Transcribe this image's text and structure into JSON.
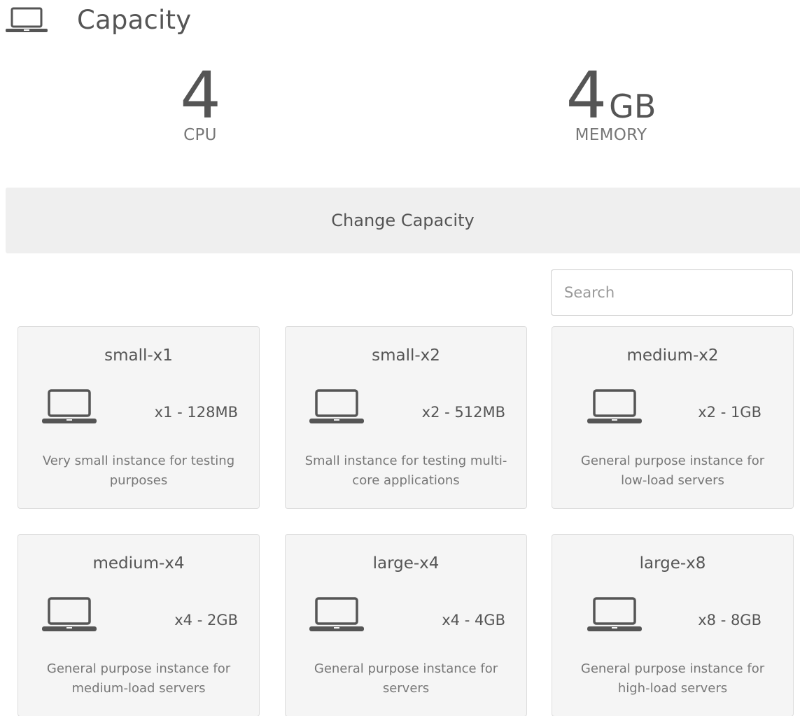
{
  "header": {
    "title": "Capacity",
    "icon": "laptop-icon"
  },
  "stats": {
    "cpu": {
      "value": "4",
      "label": "CPU"
    },
    "memory": {
      "value": "4",
      "unit": "GB",
      "label": "MEMORY"
    }
  },
  "change_button": {
    "label": "Change Capacity"
  },
  "search": {
    "placeholder": "Search",
    "value": ""
  },
  "flavors": [
    {
      "name": "small-x1",
      "spec": "x1 - 128MB",
      "description": "Very small instance for testing purposes"
    },
    {
      "name": "small-x2",
      "spec": "x2 - 512MB",
      "description": "Small instance for testing multi-core applications"
    },
    {
      "name": "medium-x2",
      "spec": "x2 - 1GB",
      "description": "General purpose instance for low-load servers"
    },
    {
      "name": "medium-x4",
      "spec": "x4 - 2GB",
      "description": "General purpose instance for medium-load servers"
    },
    {
      "name": "large-x4",
      "spec": "x4 - 4GB",
      "description": "General purpose instance for servers"
    },
    {
      "name": "large-x8",
      "spec": "x8 - 8GB",
      "description": "General purpose instance for high-load servers"
    }
  ],
  "colors": {
    "text": "#555555",
    "muted": "#777777",
    "bar_bg": "#efefef",
    "card_bg": "#f5f5f5",
    "card_border": "#dddddd"
  }
}
